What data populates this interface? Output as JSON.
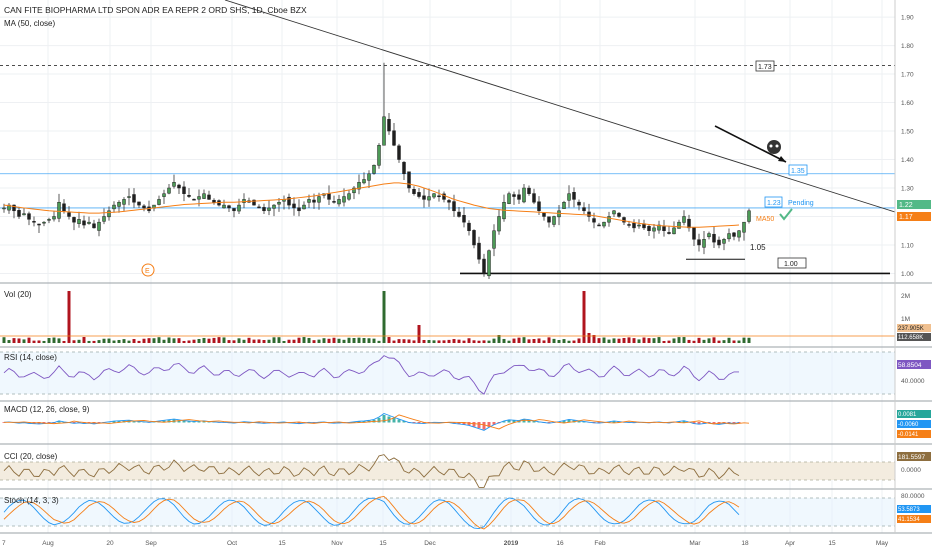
{
  "header": {
    "title": "CAN FITE BIOPHARMA LTD SPON ADR EA REPR 2 ORD SHS, 1D, Cboe BZX",
    "ma_label": "MA (50, close)"
  },
  "colors": {
    "up": "#53b987",
    "down": "#eb4d5c",
    "up_dark": "#2f6a2f",
    "down_dark": "#b0141e",
    "ma": "#f57f17",
    "blue": "#2196f3",
    "rsi": "#7e57c2",
    "macd": "#2196f3",
    "signal": "#f57f17",
    "cci": "#8d6e3f",
    "stoch_k": "#2196f3",
    "stoch_d": "#f57f17",
    "band": "#e3f2fd",
    "cci_band": "#f3ecdf"
  },
  "annotations": {
    "level_173": "1.73",
    "level_135": "1.35",
    "level_123": "1.23",
    "pending": "Pending",
    "ma50": "MA50",
    "level_105": "1.05",
    "level_100": "1.00",
    "earnings": "E",
    "price_last": "1.22",
    "ma_last": "1.17"
  },
  "price_axis": {
    "ticks": [
      "1.90",
      "1.80",
      "1.70",
      "1.60",
      "1.50",
      "1.40",
      "1.30",
      "1.20",
      "1.10",
      "1.00"
    ],
    "ticks_values": [
      1.9,
      1.8,
      1.7,
      1.6,
      1.5,
      1.4,
      1.3,
      1.2,
      1.1,
      1.0
    ]
  },
  "time_axis": {
    "labels": [
      "7",
      "Aug",
      "20",
      "Sep",
      "Oct",
      "15",
      "Nov",
      "15",
      "Dec",
      "2019",
      "16",
      "Feb",
      "Mar",
      "18",
      "Apr",
      "15",
      "May"
    ]
  },
  "panes": {
    "vol": {
      "label": "Vol (20)",
      "ticks": [
        "2M",
        "1M"
      ],
      "badge1": "237.905K",
      "badge2": "112.658K"
    },
    "rsi": {
      "label": "RSI (14, close)",
      "ticks": [
        "40.0000"
      ],
      "badge": "58.8504"
    },
    "macd": {
      "label": "MACD (12, 26, close, 9)",
      "badge1": "0.0081",
      "badge2": "-0.0060",
      "badge3": "-0.0141"
    },
    "cci": {
      "label": "CCI (20, close)",
      "ticks": [
        "0.0000"
      ],
      "badge": "181.5597"
    },
    "stoch": {
      "label": "Stoch (14, 3, 3)",
      "ticks": [
        "80.0000"
      ],
      "badge1": "53.5873",
      "badge2": "41.1534"
    }
  },
  "chart_data": {
    "type": "candlestick",
    "title": "CAN FITE BIOPHARMA LTD SPON ADR EA REPR 2 ORD SHS, 1D, Cboe BZX",
    "y_range": [
      0.97,
      1.96
    ],
    "closes": [
      1.23,
      1.24,
      1.22,
      1.2,
      1.21,
      1.19,
      1.18,
      1.17,
      1.18,
      1.19,
      1.2,
      1.25,
      1.22,
      1.2,
      1.18,
      1.19,
      1.17,
      1.18,
      1.16,
      1.18,
      1.2,
      1.22,
      1.24,
      1.25,
      1.26,
      1.27,
      1.25,
      1.24,
      1.23,
      1.22,
      1.24,
      1.26,
      1.28,
      1.3,
      1.32,
      1.3,
      1.28,
      1.27,
      1.26,
      1.27,
      1.28,
      1.26,
      1.25,
      1.24,
      1.24,
      1.23,
      1.22,
      1.24,
      1.26,
      1.25,
      1.24,
      1.23,
      1.22,
      1.23,
      1.24,
      1.25,
      1.26,
      1.24,
      1.23,
      1.22,
      1.24,
      1.26,
      1.25,
      1.27,
      1.28,
      1.26,
      1.25,
      1.26,
      1.27,
      1.28,
      1.3,
      1.32,
      1.33,
      1.35,
      1.38,
      1.45,
      1.55,
      1.5,
      1.45,
      1.4,
      1.35,
      1.3,
      1.28,
      1.27,
      1.26,
      1.27,
      1.28,
      1.27,
      1.26,
      1.25,
      1.22,
      1.2,
      1.18,
      1.15,
      1.1,
      1.05,
      1.0,
      1.08,
      1.15,
      1.2,
      1.25,
      1.28,
      1.27,
      1.26,
      1.3,
      1.28,
      1.25,
      1.22,
      1.2,
      1.18,
      1.2,
      1.22,
      1.25,
      1.28,
      1.26,
      1.24,
      1.22,
      1.2,
      1.18,
      1.17,
      1.18,
      1.2,
      1.22,
      1.2,
      1.18,
      1.17,
      1.16,
      1.17,
      1.16,
      1.15,
      1.16,
      1.17,
      1.15,
      1.14,
      1.16,
      1.18,
      1.2,
      1.16,
      1.12,
      1.1,
      1.12,
      1.14,
      1.11,
      1.1,
      1.12,
      1.14,
      1.13,
      1.15,
      1.18,
      1.22
    ],
    "ma50": [
      1.24,
      1.238,
      1.235,
      1.232,
      1.23,
      1.228,
      1.226,
      1.224,
      1.222,
      1.22,
      1.219,
      1.218,
      1.217,
      1.216,
      1.215,
      1.214,
      1.213,
      1.212,
      1.212,
      1.212,
      1.213,
      1.214,
      1.215,
      1.216,
      1.218,
      1.22,
      1.222,
      1.224,
      1.226,
      1.228,
      1.23,
      1.232,
      1.234,
      1.236,
      1.238,
      1.24,
      1.242,
      1.243,
      1.244,
      1.245,
      1.246,
      1.247,
      1.248,
      1.249,
      1.25,
      1.25,
      1.25,
      1.251,
      1.252,
      1.253,
      1.254,
      1.255,
      1.256,
      1.257,
      1.258,
      1.259,
      1.26,
      1.262,
      1.264,
      1.266,
      1.268,
      1.27,
      1.272,
      1.275,
      1.278,
      1.281,
      1.284,
      1.287,
      1.29,
      1.293,
      1.296,
      1.299,
      1.302,
      1.305,
      1.308,
      1.311,
      1.314,
      1.316,
      1.318,
      1.318,
      1.316,
      1.314,
      1.31,
      1.306,
      1.3,
      1.294,
      1.288,
      1.281,
      1.274,
      1.267,
      1.26,
      1.255,
      1.25,
      1.245,
      1.24,
      1.236,
      1.232,
      1.228,
      1.226,
      1.224,
      1.222,
      1.221,
      1.22,
      1.219,
      1.218,
      1.217,
      1.216,
      1.215,
      1.214,
      1.213,
      1.212,
      1.211,
      1.21,
      1.209,
      1.208,
      1.207,
      1.206,
      1.205,
      1.203,
      1.2,
      1.197,
      1.194,
      1.191,
      1.188,
      1.185,
      1.182,
      1.179,
      1.176,
      1.174,
      1.172,
      1.17,
      1.168,
      1.167,
      1.166,
      1.165,
      1.164,
      1.163,
      1.162,
      1.162,
      1.162,
      1.163,
      1.164,
      1.165,
      1.166,
      1.167,
      1.168,
      1.169,
      1.17
    ]
  }
}
